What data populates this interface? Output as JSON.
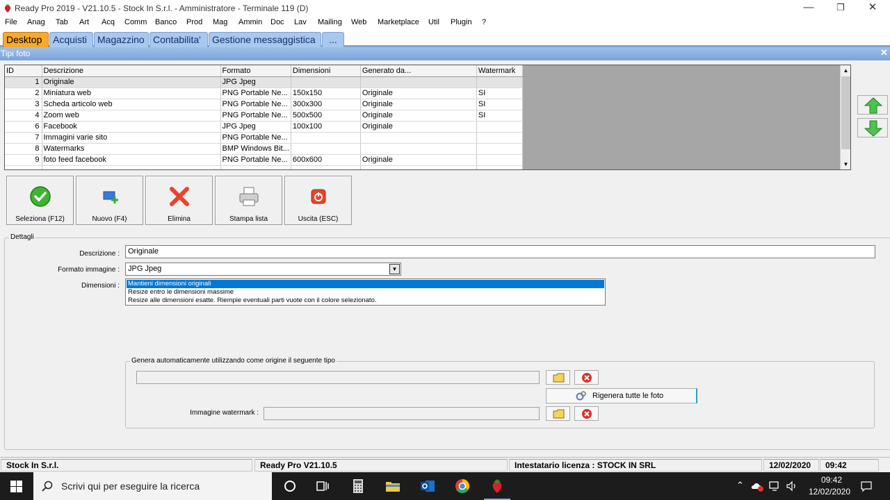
{
  "window": {
    "title": "Ready Pro 2019 - V21.10.5 - Stock In S.r.l. - Amministratore - Terminale 119 (D)",
    "minimize": "—",
    "restore": "❐",
    "close": "✕"
  },
  "menu": [
    "File",
    "Anag",
    "Tab",
    "Art",
    "Acq",
    "Comm",
    "Banco",
    "Prod",
    "Mag",
    "Ammin",
    "Doc",
    "Lav",
    "Mailing",
    "Web",
    "Marketplace",
    "Util",
    "Plugin",
    "?"
  ],
  "tabs": [
    {
      "label": "Desktop",
      "active": true
    },
    {
      "label": "Acquisti"
    },
    {
      "label": "Magazzino"
    },
    {
      "label": "Contabilita'"
    },
    {
      "label": "Gestione messaggistica"
    },
    {
      "label": "..."
    }
  ],
  "subwindow": {
    "title": "Tipi foto",
    "close": "✕"
  },
  "grid": {
    "columns": [
      "ID",
      "Descrizione",
      "Formato",
      "Dimensioni",
      "Generato da...",
      "Watermark"
    ],
    "rows": [
      [
        "1",
        "Originale",
        "JPG Jpeg",
        "",
        "",
        ""
      ],
      [
        "2",
        "Miniatura web",
        "PNG Portable Ne...",
        "150x150",
        "Originale",
        "SI"
      ],
      [
        "3",
        "Scheda articolo web",
        "PNG Portable Ne...",
        "300x300",
        "Originale",
        "SI"
      ],
      [
        "4",
        "Zoom web",
        "PNG Portable Ne...",
        "500x500",
        "Originale",
        "SI"
      ],
      [
        "6",
        "Facebook",
        "JPG Jpeg",
        "100x100",
        "Originale",
        ""
      ],
      [
        "7",
        "Immagini varie sito",
        "PNG Portable Ne...",
        "",
        "",
        ""
      ],
      [
        "8",
        "Watermarks",
        "BMP Windows Bit...",
        "",
        "",
        ""
      ],
      [
        "9",
        "foto feed facebook",
        "PNG Portable Ne...",
        "600x600",
        "Originale",
        ""
      ]
    ]
  },
  "buttons": {
    "seleziona": "Seleziona (F12)",
    "nuovo": "Nuovo (F4)",
    "elimina": "Elimina",
    "stampa": "Stampa lista",
    "uscita": "Uscita (ESC)"
  },
  "details": {
    "legend": "Dettagli",
    "descrizione_label": "Descrizione :",
    "descrizione_value": "Originale",
    "formato_label": "Formato immagine :",
    "formato_value": "JPG Jpeg",
    "dimensioni_label": "Dimensioni :",
    "dimensioni_options": [
      "Mantieni dimensioni originali",
      "Resize entro le dimensioni massime",
      "Resize alle dimensioni esatte. Riempie eventuali parti vuote con il colore selezionato."
    ],
    "genera_legend": "Genera automaticamente utilizzando come origine il seguente tipo",
    "rigenera_label": "Rigenera tutte le foto",
    "watermark_label": "Immagine watermark :"
  },
  "status": {
    "company": "Stock In S.r.l.",
    "version": "Ready Pro V21.10.5",
    "license": "Intestatario licenza : STOCK IN SRL",
    "date": "12/02/2020",
    "time": "09:42"
  },
  "taskbar": {
    "search_placeholder": "Scrivi qui per eseguire la ricerca",
    "clock_time": "09:42",
    "clock_date": "12/02/2020"
  },
  "colors": {
    "accent_tab": "#f7a930",
    "tab": "#a9c8ee",
    "selection": "#0078d7"
  }
}
